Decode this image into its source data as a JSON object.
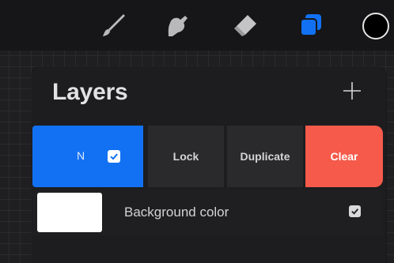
{
  "toolbar": {
    "tools": [
      {
        "icon": "brush-icon"
      },
      {
        "icon": "smudge-icon"
      },
      {
        "icon": "eraser-icon"
      },
      {
        "icon": "layers-icon",
        "active": true
      }
    ],
    "current_color": "#000000",
    "active_color": "#1271f2"
  },
  "layers_panel": {
    "title": "Layers",
    "add_icon": "plus-icon",
    "layer": {
      "blend_mode": "N",
      "visible": true,
      "actions": {
        "lock": "Lock",
        "duplicate": "Duplicate",
        "clear": "Clear"
      },
      "selected_color": "#1271f2",
      "clear_color": "#f55a4a"
    },
    "background": {
      "label": "Background color",
      "color": "#ffffff",
      "visible": true
    }
  }
}
